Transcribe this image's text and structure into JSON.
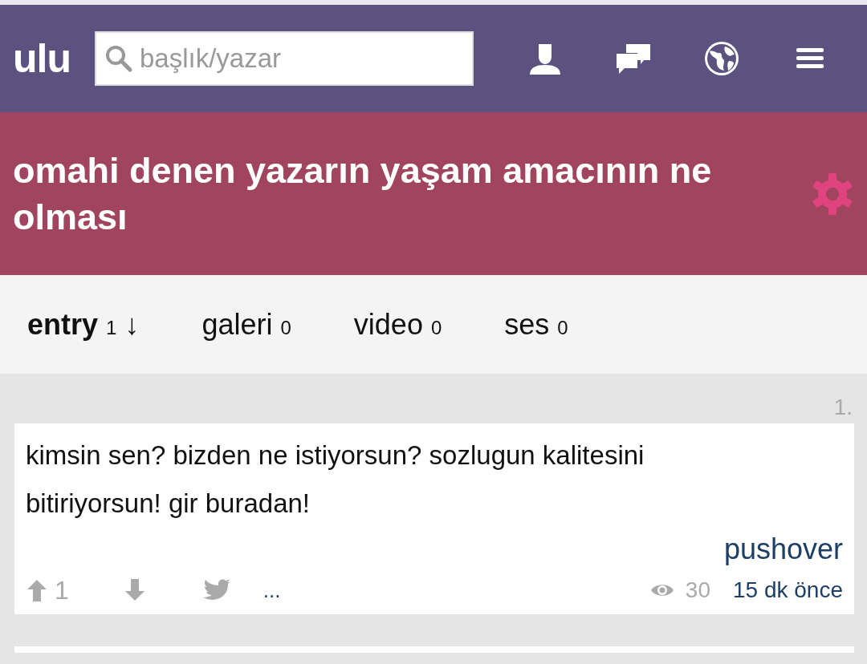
{
  "header": {
    "logo": "ulu",
    "search": {
      "placeholder": "başlık/yazar"
    }
  },
  "topic": {
    "title": "omahi denen yazarın yaşam amacının ne olması"
  },
  "tabs": [
    {
      "label": "entry",
      "count": "1",
      "sort": "↓",
      "selected": true
    },
    {
      "label": "galeri",
      "count": "0",
      "selected": false
    },
    {
      "label": "video",
      "count": "0",
      "selected": false
    },
    {
      "label": "ses",
      "count": "0",
      "selected": false
    }
  ],
  "entries": [
    {
      "number": "1.",
      "text": "kimsin sen? bizden ne istiyorsun? sozlugun kalitesini bitiriyorsun! gir buradan!",
      "upvotes": "1",
      "more": "...",
      "author": "pushover",
      "views": "30",
      "time": "15 dk önce"
    }
  ]
}
